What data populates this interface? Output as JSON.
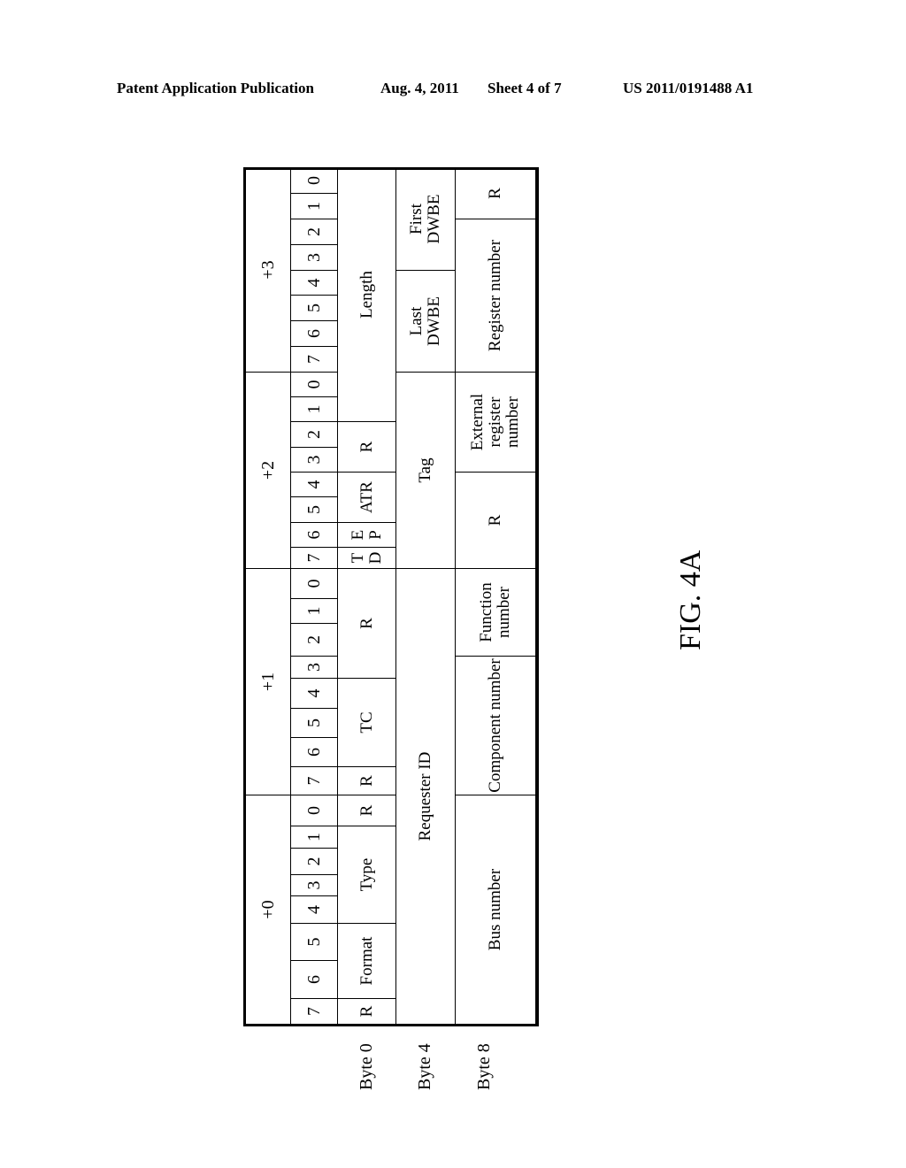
{
  "page_header": {
    "publication": "Patent Application Publication",
    "date": "Aug. 4, 2011",
    "sheet": "Sheet 4 of 7",
    "number": "US 2011/0191488 A1"
  },
  "table": {
    "byte_offsets": [
      "+0",
      "+1",
      "+2",
      "+3"
    ],
    "bit_labels": [
      "7",
      "6",
      "5",
      "4",
      "3",
      "2",
      "1",
      "0"
    ],
    "row_labels": [
      "Byte 0",
      "Byte 4",
      "Byte 8"
    ],
    "rows": [
      {
        "name": "byte-0",
        "fields": [
          {
            "label": "R",
            "bits": 1
          },
          {
            "label": "Format",
            "bits": 2
          },
          {
            "label": "Type",
            "bits": 4
          },
          {
            "label": "R",
            "bits": 1
          },
          {
            "label": "R",
            "bits": 1
          },
          {
            "label": "TC",
            "bits": 3
          },
          {
            "label": "R",
            "bits": 4
          },
          {
            "label": "T D",
            "bits": 1
          },
          {
            "label": "E P",
            "bits": 1
          },
          {
            "label": "ATR",
            "bits": 2
          },
          {
            "label": "R",
            "bits": 2
          },
          {
            "label": "Length",
            "bits": 10
          }
        ]
      },
      {
        "name": "byte-4",
        "fields": [
          {
            "label": "Requester ID",
            "bits": 16
          },
          {
            "label": "Tag",
            "bits": 8
          },
          {
            "label": "Last DWBE",
            "bits": 4
          },
          {
            "label": "First DWBE",
            "bits": 4
          }
        ]
      },
      {
        "name": "byte-8",
        "fields": [
          {
            "label": "Bus number",
            "bits": 8
          },
          {
            "label": "Component number",
            "bits": 5
          },
          {
            "label": "Function number",
            "bits": 3
          },
          {
            "label": "R",
            "bits": 4
          },
          {
            "label": "External register number",
            "bits": 4
          },
          {
            "label": "Register number",
            "bits": 6
          },
          {
            "label": "R",
            "bits": 2
          }
        ]
      }
    ]
  },
  "caption": "FIG. 4A"
}
